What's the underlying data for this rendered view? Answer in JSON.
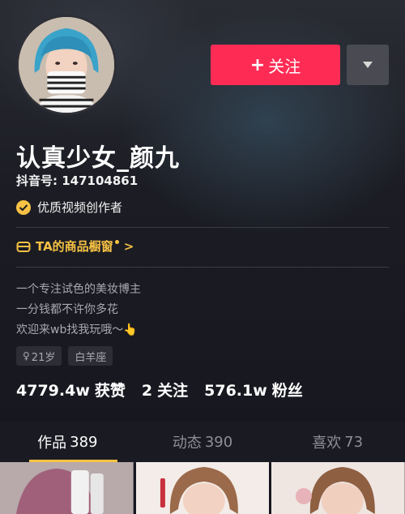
{
  "profile": {
    "name": "认真少女_颜九",
    "douyin_id": "抖音号: 147104861",
    "creator_badge": "优质视频创作者"
  },
  "actions": {
    "follow_plus": "+",
    "follow_label": "关注"
  },
  "shop": {
    "label": "TA的商品橱窗",
    "arrow": ">"
  },
  "bio": {
    "line1": "一个专注试色的美妆博主",
    "line2": "一分钱都不许你多花",
    "line3": "欢迎来wb找我玩哦～👆"
  },
  "tags": {
    "age": "21岁",
    "age_icon": "♀",
    "zodiac": "白羊座"
  },
  "stats": {
    "likes_num": "4779.4w",
    "likes_label": "获赞",
    "following_num": "2",
    "following_label": "关注",
    "followers_num": "576.1w",
    "followers_label": "粉丝"
  },
  "tabs": [
    {
      "label": "作品",
      "count": "389"
    },
    {
      "label": "动态",
      "count": "390"
    },
    {
      "label": "喜欢",
      "count": "73"
    }
  ],
  "colors": {
    "accent": "#fe2c55",
    "gold": "#f7c244",
    "background": "#16171f"
  },
  "icons": {
    "badge": "verified-check-icon",
    "shop": "shop-bag-icon",
    "more": "triangle-down-icon"
  }
}
